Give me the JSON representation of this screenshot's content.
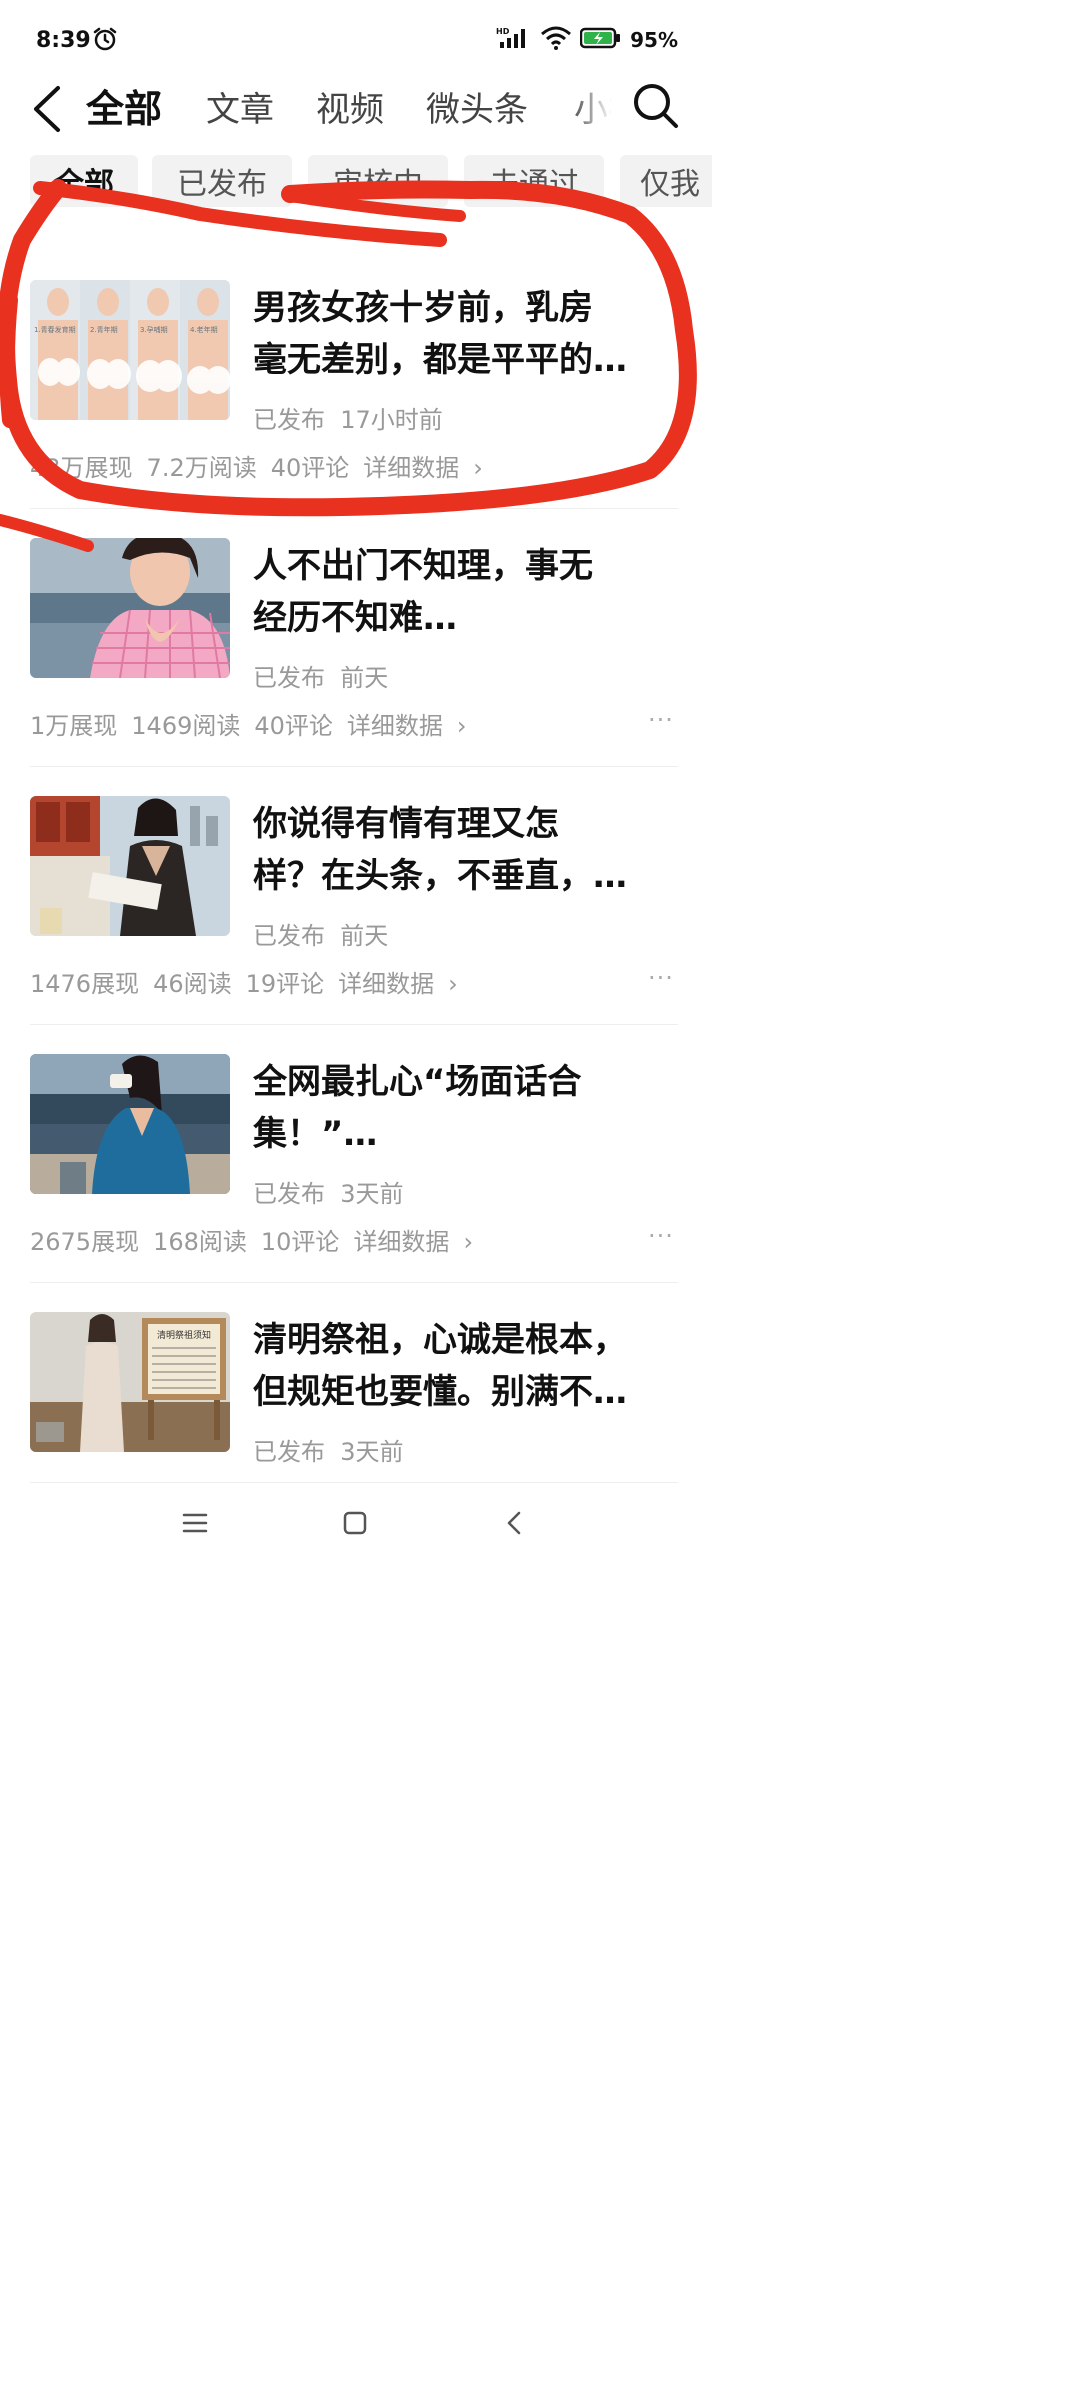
{
  "status": {
    "time": "8:39",
    "battery": "95%",
    "network": "HD"
  },
  "nav": {
    "tabs": [
      "全部",
      "文章",
      "视频",
      "微头条",
      "小视"
    ],
    "active": 0
  },
  "filters": [
    "全部",
    "已发布",
    "审核中",
    "未通过",
    "仅我"
  ],
  "items": [
    {
      "title_line1": "男孩女孩十岁前，乳房",
      "title_line2": "毫无差别，都是平平的…",
      "status": "已发布",
      "time": "17小时前",
      "impressions": "43万展现",
      "reads": "7.2万阅读",
      "comments": "40评论",
      "details": "详细数据",
      "thumb_labels": [
        "1.青春发育期",
        "2.青年期",
        "3.孕哺期",
        "4.老年期"
      ]
    },
    {
      "title_line1": "人不出门不知理，事无",
      "title_line2": "经历不知难…",
      "status": "已发布",
      "time": "前天",
      "impressions": "1万展现",
      "reads": "1469阅读",
      "comments": "40评论",
      "details": "详细数据"
    },
    {
      "title_line1": "你说得有情有理又怎",
      "title_line2": "样？在头条，不垂直，…",
      "status": "已发布",
      "time": "前天",
      "impressions": "1476展现",
      "reads": "46阅读",
      "comments": "19评论",
      "details": "详细数据"
    },
    {
      "title_line1": "全网最扎心“场面话合",
      "title_line2": "集！”…",
      "status": "已发布",
      "time": "3天前",
      "impressions": "2675展现",
      "reads": "168阅读",
      "comments": "10评论",
      "details": "详细数据"
    },
    {
      "title_line1": "清明祭祖，心诚是根本，",
      "title_line2": "但规矩也要懂。别满不…",
      "status": "已发布",
      "time": "3天前",
      "sign_title": "清明祭祖须知"
    }
  ],
  "more_label": "···",
  "chevron": "›",
  "colors": {
    "annotation": "#e8311f",
    "text": "#111111",
    "muted": "#999999",
    "chip_bg": "#f2f2f2"
  }
}
